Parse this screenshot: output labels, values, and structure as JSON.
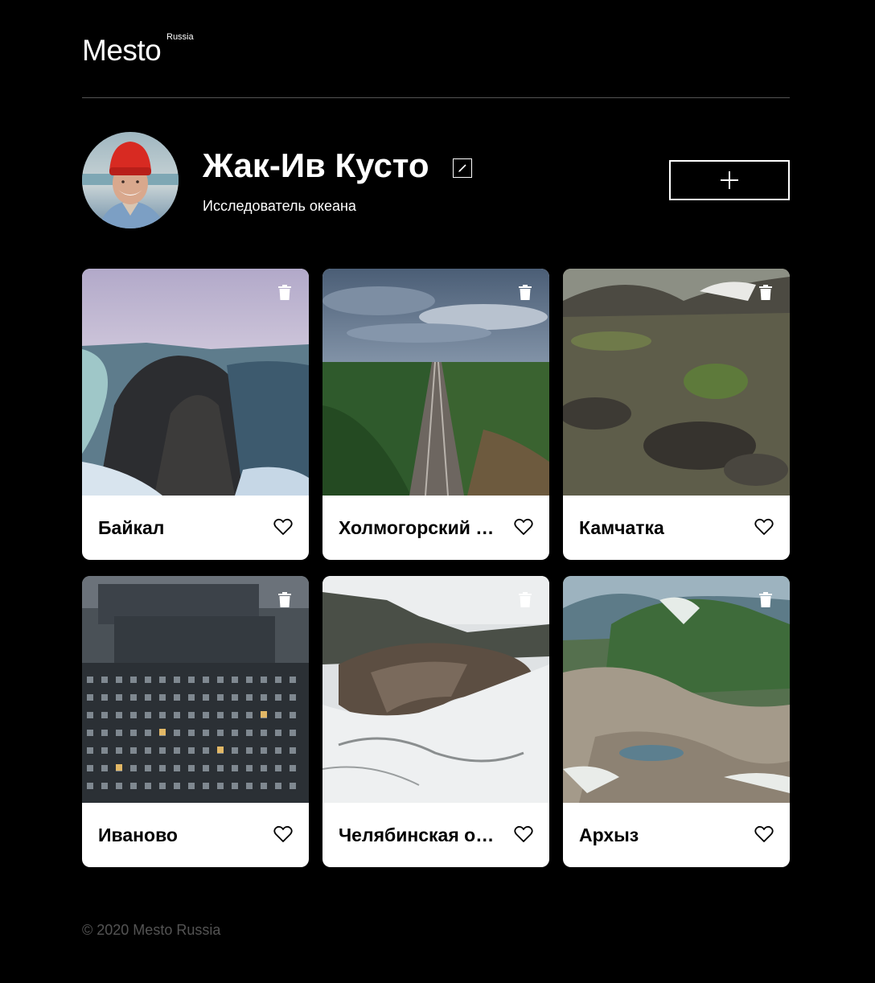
{
  "header": {
    "logo": "Mesto",
    "logo_sub": "Russia"
  },
  "profile": {
    "name": "Жак-Ив Кусто",
    "about": "Исследователь океана"
  },
  "cards": [
    {
      "title": "Байкал",
      "image": "baikal-photo"
    },
    {
      "title": "Холмогорский район",
      "image": "railway-photo"
    },
    {
      "title": "Камчатка",
      "image": "kamchatka-photo"
    },
    {
      "title": "Иваново",
      "image": "ivanovo-photo"
    },
    {
      "title": "Челябинская область",
      "image": "chelyabinsk-photo"
    },
    {
      "title": "Архыз",
      "image": "arkhyz-photo"
    }
  ],
  "footer": {
    "copyright": "© 2020 Mesto Russia"
  },
  "icons": {
    "edit": "edit-icon",
    "add": "plus-icon",
    "like": "heart-icon",
    "delete": "trash-icon"
  },
  "colors": {
    "background": "#000000",
    "card": "#ffffff",
    "divider": "#545454",
    "footer_text": "#545454"
  }
}
